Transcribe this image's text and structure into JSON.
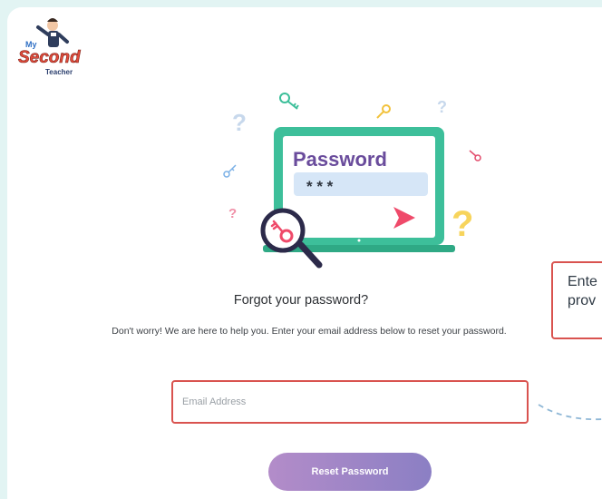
{
  "logo": {
    "line1": "My",
    "line2": "Second",
    "line3": "Teacher"
  },
  "illustration": {
    "screen_title": "Password",
    "masked_input": "* * *",
    "icons": [
      "question-mark-icon",
      "key-icon",
      "magnifier-icon",
      "cursor-arrow-icon"
    ]
  },
  "heading": "Forgot your password?",
  "subtext": "Don't worry! We are here to help you. Enter your email address below to reset your password.",
  "email": {
    "placeholder": "Email Address",
    "value": ""
  },
  "reset_button": "Reset Password",
  "tooltip": {
    "line1": "Ente",
    "line2": "prov"
  },
  "colors": {
    "accent_red": "#d9534f",
    "button_start": "#b38cc9",
    "button_end": "#8b7fc4",
    "laptop_green": "#3dbf9a",
    "password_purple": "#6a4c9c"
  }
}
